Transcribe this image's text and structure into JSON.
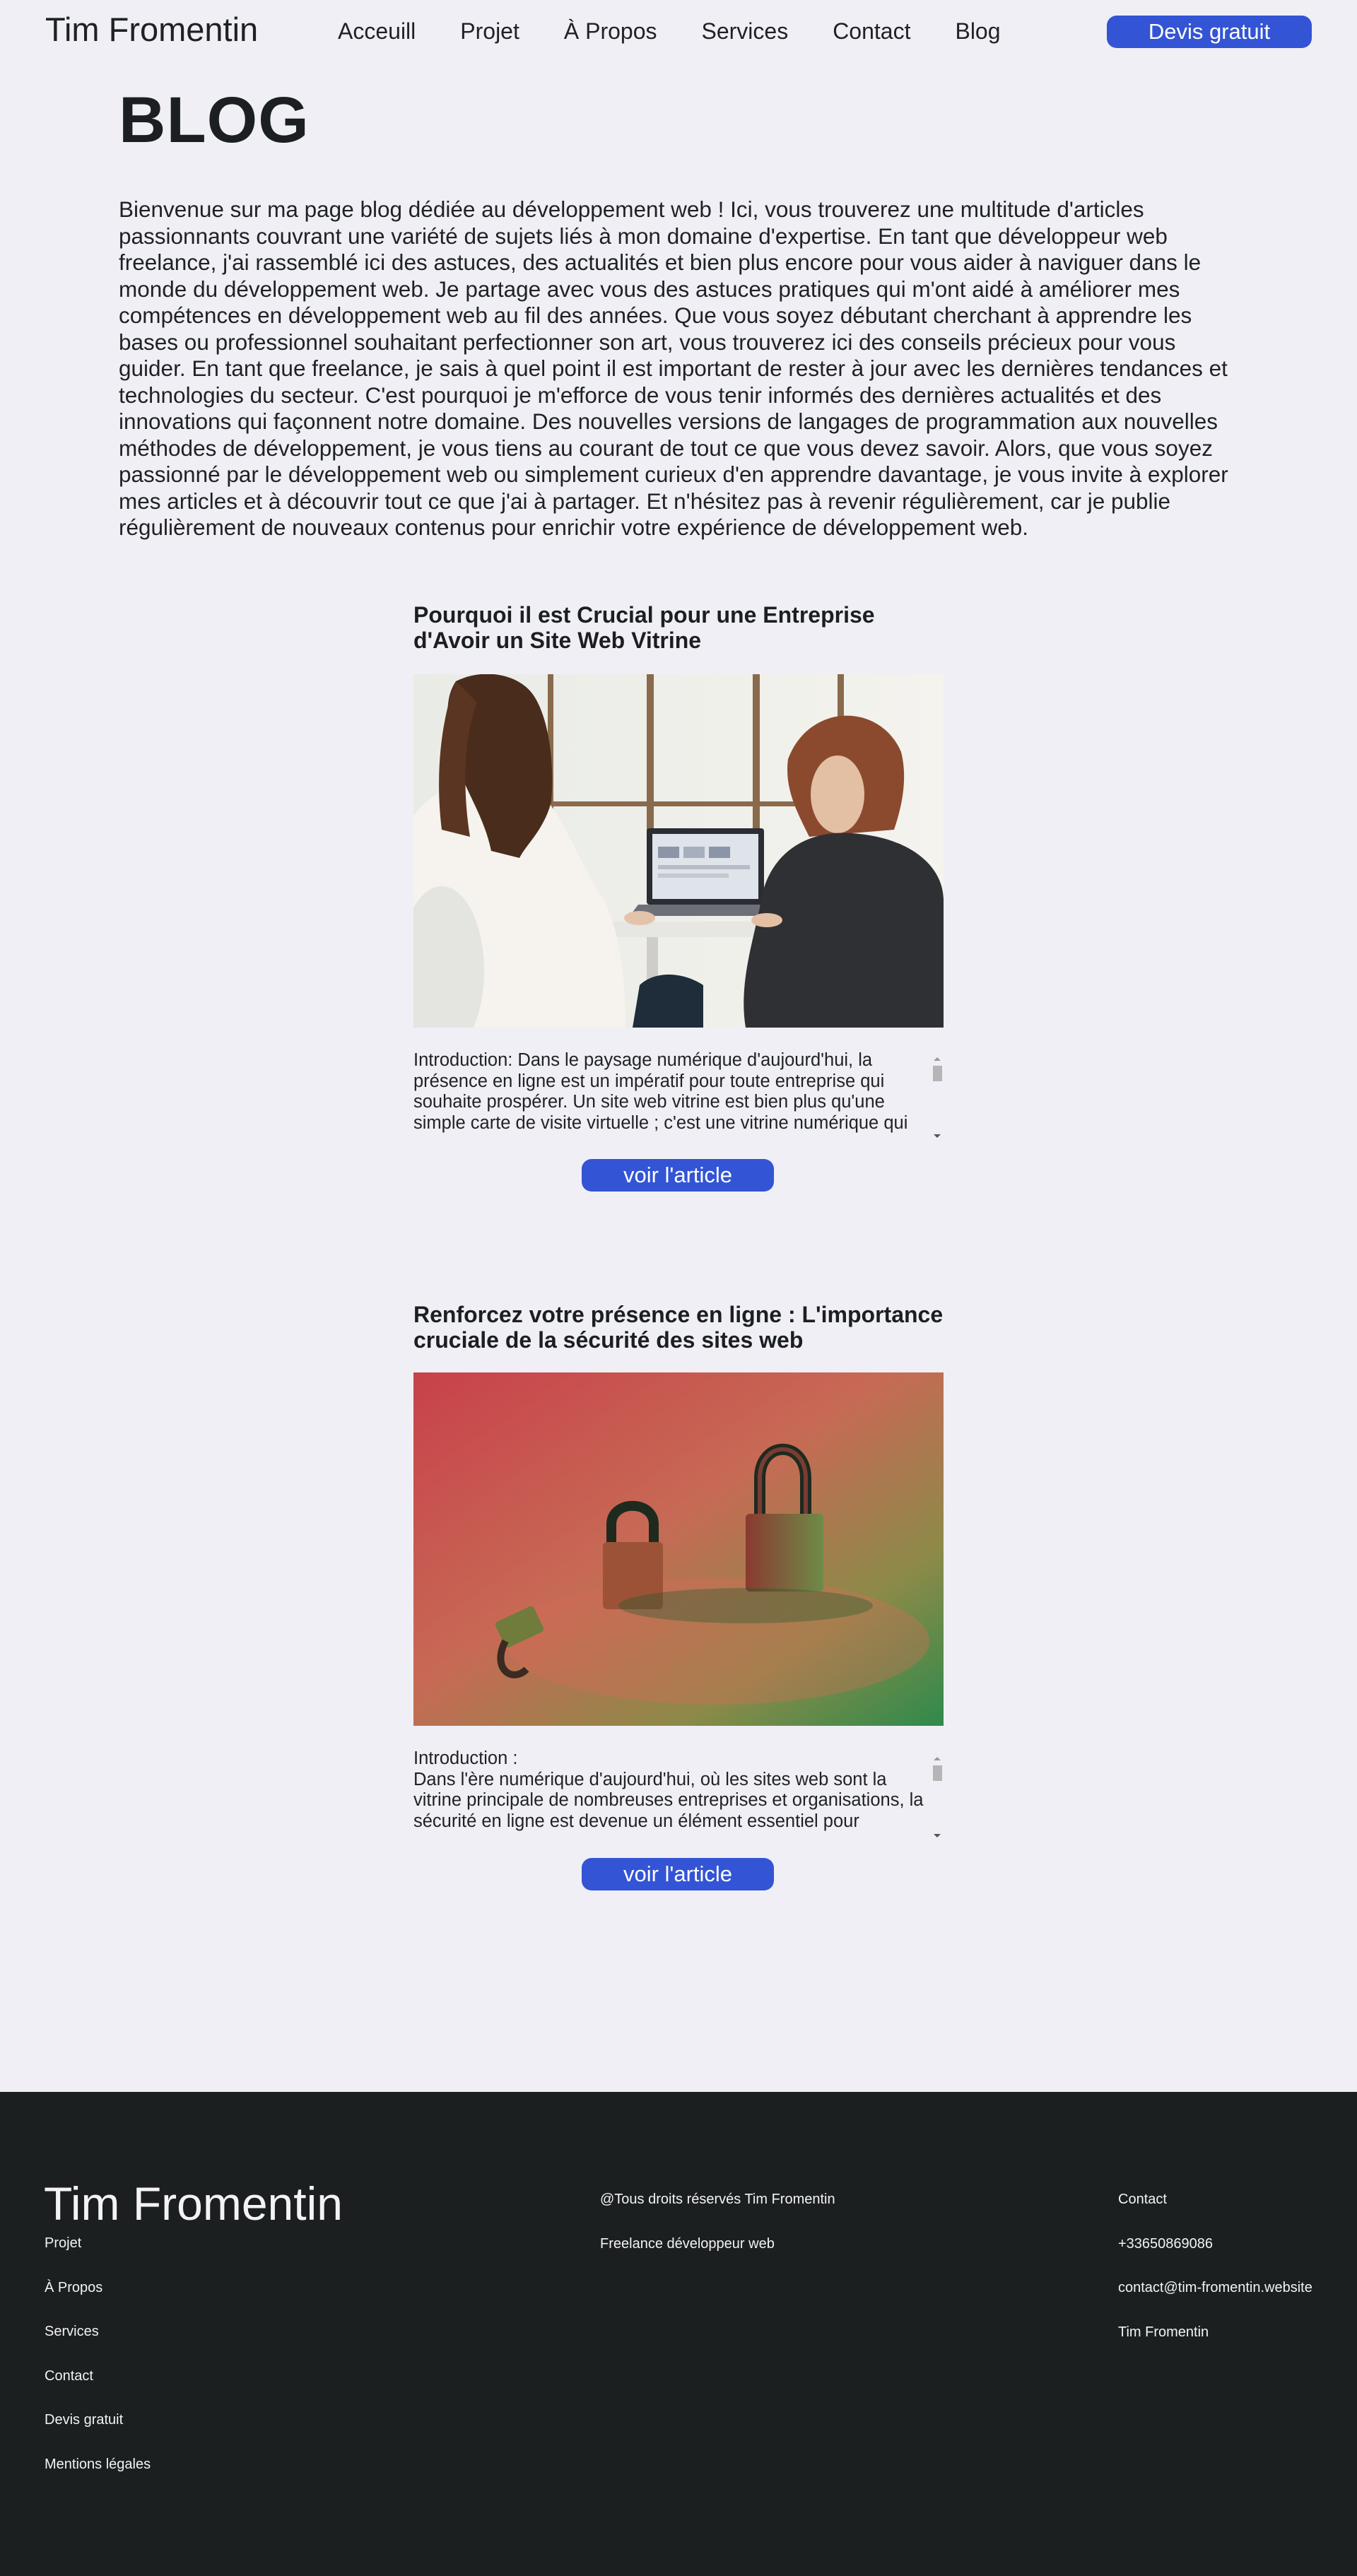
{
  "header": {
    "brand": "Tim Fromentin",
    "nav": [
      "Acceuill",
      "Projet",
      "À Propos",
      "Services",
      "Contact",
      "Blog"
    ],
    "cta": "Devis gratuit"
  },
  "page": {
    "title": "BLOG",
    "intro": "Bienvenue sur ma page blog dédiée au développement web ! Ici, vous trouverez une multitude d'articles passionnants couvrant une variété de sujets liés à mon domaine d'expertise. En tant que développeur web freelance, j'ai rassemblé ici des astuces, des actualités et bien plus encore pour vous aider à naviguer dans le monde du développement web. Je partage avec vous des astuces pratiques qui m'ont aidé à améliorer mes compétences en développement web au fil des années. Que vous soyez débutant cherchant à apprendre les bases ou professionnel souhaitant perfectionner son art, vous trouverez ici des conseils précieux pour vous guider. En tant que freelance, je sais à quel point il est important de rester à jour avec les dernières tendances et technologies du secteur. C'est pourquoi je m'efforce de vous tenir informés des dernières actualités et des innovations qui façonnent notre domaine. Des nouvelles versions de langages de programmation aux nouvelles méthodes de développement, je vous tiens au courant de tout ce que vous devez savoir. Alors, que vous soyez passionné par le développement web ou simplement curieux d'en apprendre davantage, je vous invite à explorer mes articles et à découvrir tout ce que j'ai à partager. Et n'hésitez pas à revenir régulièrement, car je publie régulièrement de nouveaux contenus pour enrichir votre expérience de développement web."
  },
  "articles": [
    {
      "title": "Pourquoi il est Crucial pour une Entreprise d'Avoir un Site Web Vitrine",
      "excerpt": "Introduction: Dans le paysage numérique d'aujourd'hui, la présence en ligne est un impératif pour toute entreprise qui souhaite prospérer. Un site web vitrine est bien plus qu'une simple carte de visite virtuelle ; c'est une vitrine numérique qui permet aux entreprises de mettre en valeur leur identité.",
      "button": "voir l'article"
    },
    {
      "title": "Renforcez votre présence en ligne : L'importance cruciale de la sécurité des sites web",
      "excerpt_heading": "Introduction :",
      "excerpt": "Dans l'ère numérique d'aujourd'hui, où les sites web sont la vitrine principale de nombreuses entreprises et organisations, la sécurité en ligne est devenue un élément essentiel pour maintenir une présence en ligne fiable et sécurisée. Protéger votre site.",
      "button": "voir l'article"
    }
  ],
  "footer": {
    "brand": "Tim Fromentin",
    "links": [
      "Projet",
      "À Propos",
      "Services",
      "Contact",
      "Devis gratuit",
      "Mentions légales"
    ],
    "middle": [
      "@Tous droits réservés Tim Fromentin",
      "Freelance développeur web"
    ],
    "right": [
      "Contact",
      "+33650869086",
      "contact@tim-fromentin.website",
      "Tim Fromentin"
    ]
  },
  "colors": {
    "background": "#efeff5",
    "accent": "#3354d4",
    "footer": "#1b1f20"
  }
}
